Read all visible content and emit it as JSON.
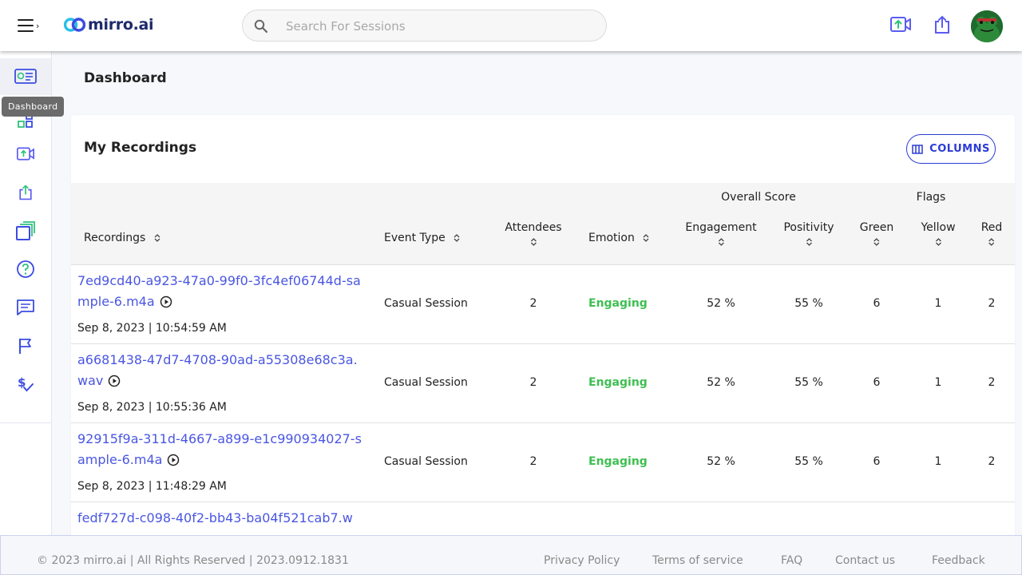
{
  "header": {
    "logo_text": "mirro.ai",
    "search_placeholder": "Search For Sessions",
    "search_value": "",
    "actions": [
      "upload-video-icon",
      "share-icon"
    ],
    "avatar": "user-avatar"
  },
  "sidebar": {
    "tooltip": "Dashboard",
    "items": [
      {
        "name": "dashboard",
        "icon": "dashboard-icon",
        "active": true
      },
      {
        "name": "integrations",
        "icon": "apps-icon"
      },
      {
        "name": "upload",
        "icon": "upload-video-icon"
      },
      {
        "name": "share",
        "icon": "share-icon"
      },
      {
        "name": "library",
        "icon": "stack-icon"
      },
      {
        "name": "help",
        "icon": "help-icon"
      },
      {
        "name": "feedback",
        "icon": "chat-icon"
      },
      {
        "name": "flags",
        "icon": "flag-icon"
      },
      {
        "name": "billing",
        "icon": "dollar-check-icon"
      }
    ]
  },
  "page": {
    "title": "Dashboard"
  },
  "card": {
    "title": "My Recordings",
    "columns_button": "COLUMNS"
  },
  "table": {
    "group_headers": {
      "overall_score": "Overall Score",
      "flags": "Flags"
    },
    "columns": {
      "recordings": "Recordings",
      "event_type": "Event Type",
      "attendees": "Attendees",
      "emotion": "Emotion",
      "engagement": "Engagement",
      "positivity": "Positivity",
      "green": "Green",
      "yellow": "Yellow",
      "red": "Red"
    },
    "rows": [
      {
        "recording": "7ed9cd40-a923-47a0-99f0-3fc4ef06744d-sample-6.m4a",
        "date": "Sep 8, 2023 | 10:54:59 AM",
        "event_type": "Casual Session",
        "attendees": "2",
        "emotion": "Engaging",
        "engagement": "52 %",
        "positivity": "55 %",
        "green": "6",
        "yellow": "1",
        "red": "2"
      },
      {
        "recording": "a6681438-47d7-4708-90ad-a55308e68c3a.wav",
        "date": "Sep 8, 2023 | 10:55:36 AM",
        "event_type": "Casual Session",
        "attendees": "2",
        "emotion": "Engaging",
        "engagement": "52 %",
        "positivity": "55 %",
        "green": "6",
        "yellow": "1",
        "red": "2"
      },
      {
        "recording": "92915f9a-311d-4667-a899-e1c990934027-sample-6.m4a",
        "date": "Sep 8, 2023 | 11:48:29 AM",
        "event_type": "Casual Session",
        "attendees": "2",
        "emotion": "Engaging",
        "engagement": "52 %",
        "positivity": "55 %",
        "green": "6",
        "yellow": "1",
        "red": "2"
      },
      {
        "recording": "fedf727d-c098-40f2-bb43-ba04f521cab7.w",
        "date": "",
        "event_type": "",
        "attendees": "",
        "emotion": "",
        "engagement": "",
        "positivity": "",
        "green": "",
        "yellow": "",
        "red": ""
      }
    ]
  },
  "footer": {
    "copyright": "© 2023 mirro.ai | All Rights Reserved | 2023.0912.1831",
    "links": [
      "Privacy Policy",
      "Terms of service",
      "FAQ",
      "Contact us",
      "Feedback"
    ]
  },
  "colors": {
    "accent": "#4a56e2",
    "button_blue": "#2b3cd6",
    "emotion_green": "#3fbf52"
  }
}
